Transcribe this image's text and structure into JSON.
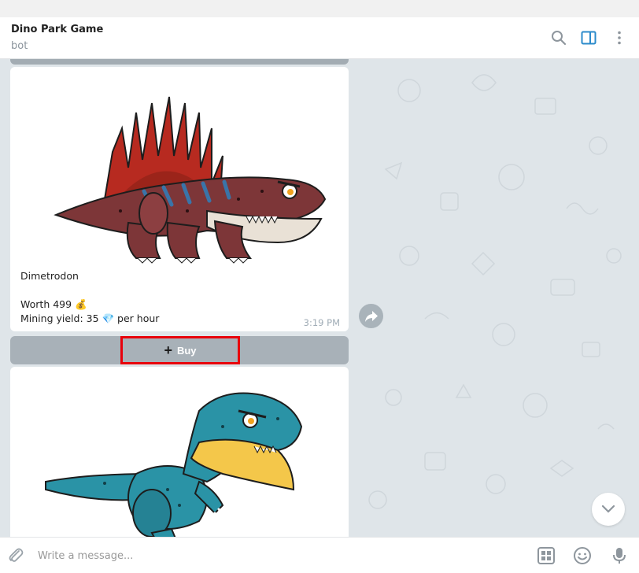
{
  "header": {
    "title": "Dino Park Game",
    "subtitle": "bot",
    "icons": [
      "search-icon",
      "sidebar-toggle-icon",
      "more-vertical-icon"
    ]
  },
  "messages": [
    {
      "image": "dimetrodon-illustration",
      "name": "Dimetrodon",
      "worth_line": "Worth 499 💰",
      "mining_line": "Mining yield: 35 💎 per hour",
      "time": "3:19 PM"
    },
    {
      "image": "raptor-illustration"
    }
  ],
  "inline_keyboard": {
    "buy_label": "Buy",
    "buy_icon": "plus-icon"
  },
  "composer": {
    "placeholder": "Write a message...",
    "icons": [
      "attach-icon",
      "bot-commands-icon",
      "emoji-icon",
      "microphone-icon"
    ]
  },
  "colors": {
    "header_bg": "#ffffff",
    "chat_bg": "#dfe5e9",
    "accent": "#2c8bcb",
    "highlight_border": "#e8000b"
  }
}
